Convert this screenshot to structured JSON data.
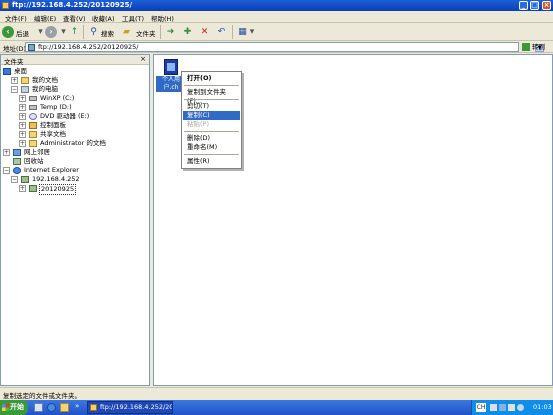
{
  "window": {
    "title": "ftp://192.168.4.252/20120925/"
  },
  "menu": [
    "文件(F)",
    "编辑(E)",
    "查看(V)",
    "收藏(A)",
    "工具(T)",
    "帮助(H)"
  ],
  "toolbar": {
    "back_label": "后退",
    "search_label": "搜索",
    "folders_label": "文件夹"
  },
  "address": {
    "label": "地址(D)",
    "value": "ftp://192.168.4.252/20120925/",
    "go_label": "转到"
  },
  "folders_pane": {
    "title": "文件夹",
    "tree": [
      {
        "label": "桌面"
      },
      {
        "label": "我的文档"
      },
      {
        "label": "我的电脑"
      },
      {
        "label": "WinXP (C:)"
      },
      {
        "label": "Temp (D:)"
      },
      {
        "label": "DVD 驱动器 (E:)"
      },
      {
        "label": "控制面板"
      },
      {
        "label": "共享文档"
      },
      {
        "label": "Administrator 的文档"
      },
      {
        "label": "网上邻居"
      },
      {
        "label": "回收站"
      },
      {
        "label": "Internet Explorer"
      },
      {
        "label": "192.168.4.252"
      },
      {
        "label": "20120925"
      }
    ]
  },
  "file": {
    "name_line1": "个人用",
    "name_line2": "户.ch"
  },
  "context_menu": [
    {
      "label": "打开(O)",
      "state": "bold"
    },
    {
      "label": "复制到文件夹(F)...",
      "state": "normal"
    },
    {
      "label": "剪切(T)",
      "state": "normal"
    },
    {
      "label": "复制(C)",
      "state": "highlighted"
    },
    {
      "label": "粘贴(P)",
      "state": "disabled"
    },
    {
      "label": "删除(D)",
      "state": "normal"
    },
    {
      "label": "重命名(M)",
      "state": "normal"
    },
    {
      "label": "属性(R)",
      "state": "normal"
    }
  ],
  "status": {
    "text": "复制选定的文件或文件夹。"
  },
  "taskbar": {
    "start_label": "开始",
    "task_label": "ftp://192.168.4.252/201...",
    "lang": "CH",
    "clock": "01:03"
  },
  "colors": {
    "title": "#0a3fb8",
    "selection": "#316ac5",
    "taskbar": "#2152c8",
    "start": "#3a9a3a"
  }
}
